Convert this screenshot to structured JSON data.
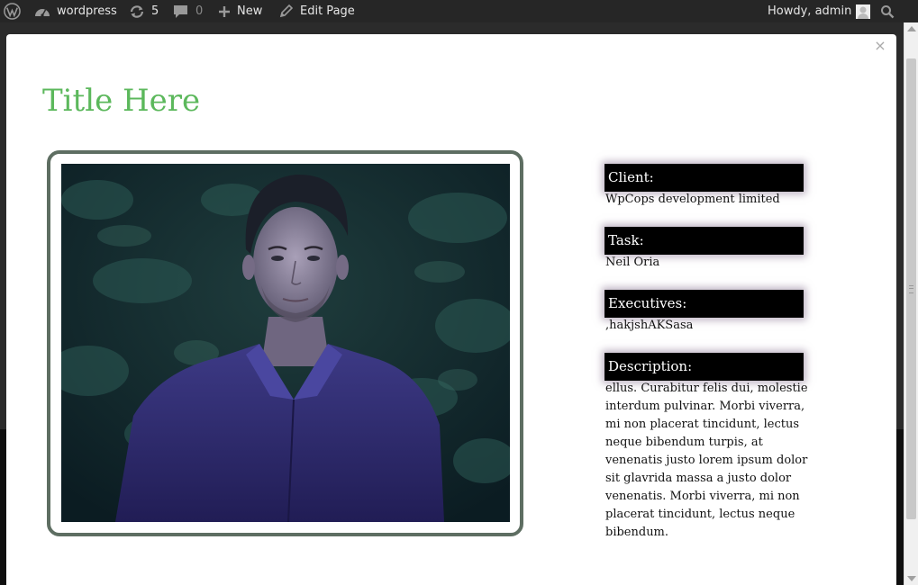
{
  "adminbar": {
    "site_name": "wordpress",
    "updates_count": "5",
    "comments_count": "0",
    "new_label": "New",
    "edit_label": "Edit Page",
    "howdy": "Howdy, admin"
  },
  "modal": {
    "close_symbol": "×",
    "title": "Title Here",
    "fields": [
      {
        "label": "Client:",
        "value": "WpCops development limited"
      },
      {
        "label": "Task:",
        "value": "Neil Oria"
      },
      {
        "label": "Executives:",
        "value": ",hakjshAKSasa"
      },
      {
        "label": "Description:",
        "value": "ellus. Curabitur felis dui, molestie interdum pulvinar. Morbi viverra, mi non placerat tincidunt, lectus neque bibendum turpis, at venenatis justo lorem ipsum dolor sit glavrida massa a justo dolor venenatis. Morbi viverra, mi non placerat tincidunt, lectus neque bibendum."
      }
    ]
  },
  "colors": {
    "title_green": "#5cb85c",
    "frame_border": "#5e6e62",
    "adminbar_bg": "#262626",
    "label_bg": "#000000"
  },
  "icons": {
    "wp_logo": "wordpress-logo-icon",
    "dashboard": "dashboard-icon",
    "updates": "updates-icon",
    "comments": "comment-icon",
    "new": "plus-icon",
    "edit": "pencil-icon",
    "avatar": "avatar-icon",
    "search": "search-icon"
  }
}
